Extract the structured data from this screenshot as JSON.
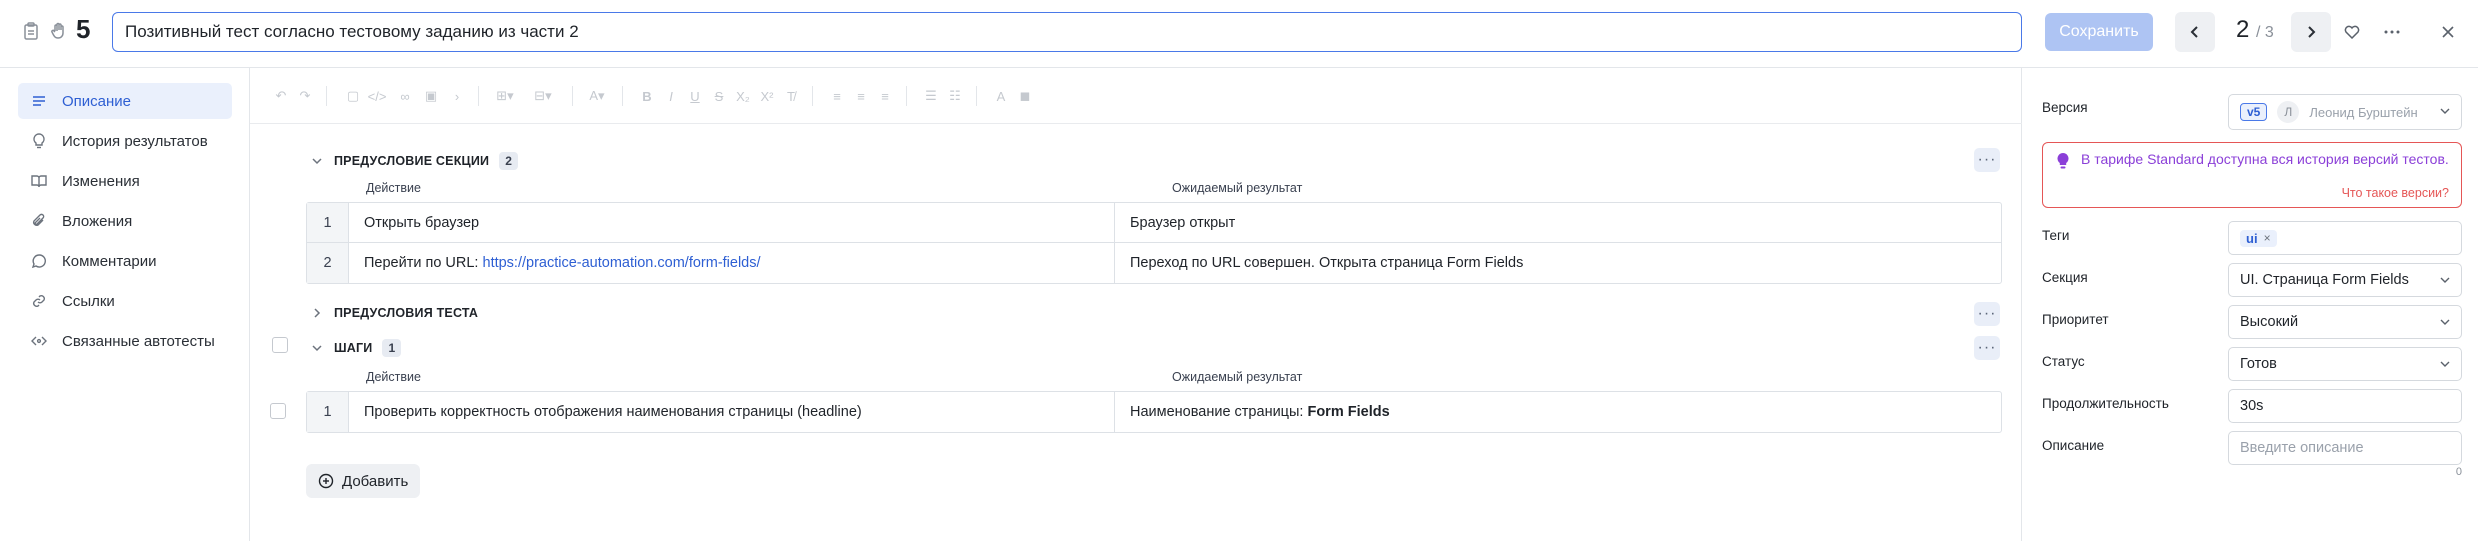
{
  "header": {
    "test_number": "5",
    "title_value": "Позитивный тест согласно тестовому заданию из части 2",
    "save_label": "Сохранить",
    "pager_current": "2",
    "pager_total": "/ 3"
  },
  "sidebar": {
    "items": [
      {
        "label": "Описание",
        "icon": "list-icon",
        "active": true
      },
      {
        "label": "История результатов",
        "icon": "lightbulb-icon",
        "active": false
      },
      {
        "label": "Изменения",
        "icon": "book-icon",
        "active": false
      },
      {
        "label": "Вложения",
        "icon": "paperclip-icon",
        "active": false
      },
      {
        "label": "Комментарии",
        "icon": "comment-icon",
        "active": false
      },
      {
        "label": "Ссылки",
        "icon": "link-icon",
        "active": false
      },
      {
        "label": "Связанные автотесты",
        "icon": "code-icon",
        "active": false
      }
    ]
  },
  "editor": {
    "precondition_section": {
      "title": "ПРЕДУСЛОВИЕ СЕКЦИИ",
      "count": "2",
      "col_action": "Действие",
      "col_result": "Ожидаемый результат",
      "rows": [
        {
          "num": "1",
          "action": "Открыть браузер",
          "result": "Браузер открыт"
        },
        {
          "num": "2",
          "action_prefix": "Перейти по URL: ",
          "action_link": "https://practice-automation.com/form-fields/",
          "result": "Переход по URL совершен. Открыта страница Form Fields"
        }
      ]
    },
    "test_preconditions": {
      "title": "ПРЕДУСЛОВИЯ ТЕСТА"
    },
    "steps": {
      "title": "ШАГИ",
      "count": "1",
      "col_action": "Действие",
      "col_result": "Ожидаемый результат",
      "rows": [
        {
          "num": "1",
          "action": "Проверить корректность отображения наименования страницы (headline)",
          "result_prefix": "Наименование страницы: ",
          "result_bold": "Form Fields"
        }
      ]
    },
    "add_label": "Добавить"
  },
  "properties": {
    "version_label": "Версия",
    "version_badge": "v5",
    "version_avatar": "Л",
    "version_user": "Леонид Бурштейн",
    "notice_text": "В тарифе Standard доступна вся история версий тестов.",
    "notice_link": "Что такое версии?",
    "tags_label": "Теги",
    "tag": "ui",
    "section_label": "Секция",
    "section_value": "UI. Страница Form Fields",
    "priority_label": "Приоритет",
    "priority_value": "Высокий",
    "status_label": "Статус",
    "status_value": "Готов",
    "duration_label": "Продолжительность",
    "duration_value": "30s",
    "description_label": "Описание",
    "description_placeholder": "Введите описание",
    "description_counter": "0"
  },
  "colors": {
    "accent": "#2e5fd3",
    "focus_border": "#4a79e8",
    "save_disabled": "#aec4f3",
    "notice_border": "#e55656",
    "notice_text": "#8b3fd8"
  }
}
